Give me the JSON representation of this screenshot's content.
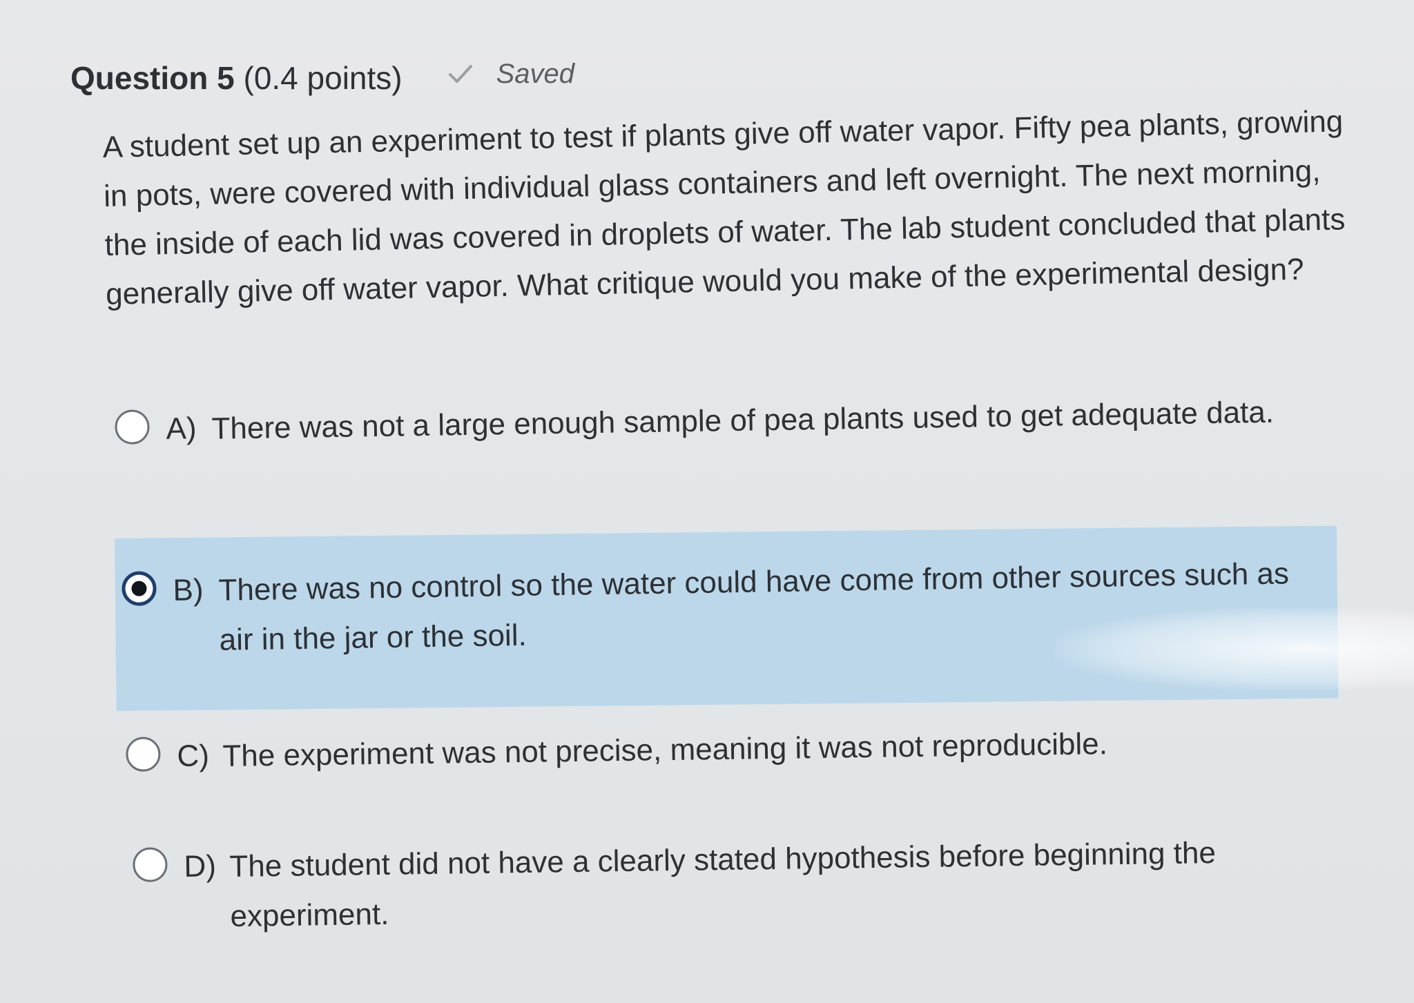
{
  "question": {
    "label": "Question 5",
    "points": "(0.4 points)",
    "status": "Saved",
    "status_icon": "checkmark-icon",
    "prompt": "A student set up an experiment to test if plants give off water vapor. Fifty pea plants, growing in pots, were covered with individual glass containers and left overnight. The next morning, the inside of each lid was covered in droplets of water. The lab student concluded that plants generally give off water vapor. What critique would you make of the experimental design?"
  },
  "options": [
    {
      "letter": "A)",
      "text": "There was not a large enough sample of pea plants used to get adequate data.",
      "selected": false
    },
    {
      "letter": "B)",
      "text": "There was no control so the water could have come from other sources such as air in the jar or the soil.",
      "selected": true
    },
    {
      "letter": "C)",
      "text": "The experiment was not precise, meaning it was not reproducible.",
      "selected": false
    },
    {
      "letter": "D)",
      "text": "The student did not have a clearly stated hypothesis before beginning the experiment.",
      "selected": false
    }
  ],
  "colors": {
    "selected_highlight": "#bcd7ea",
    "selected_radio": "#1f3f6b",
    "text": "#2c3136"
  }
}
